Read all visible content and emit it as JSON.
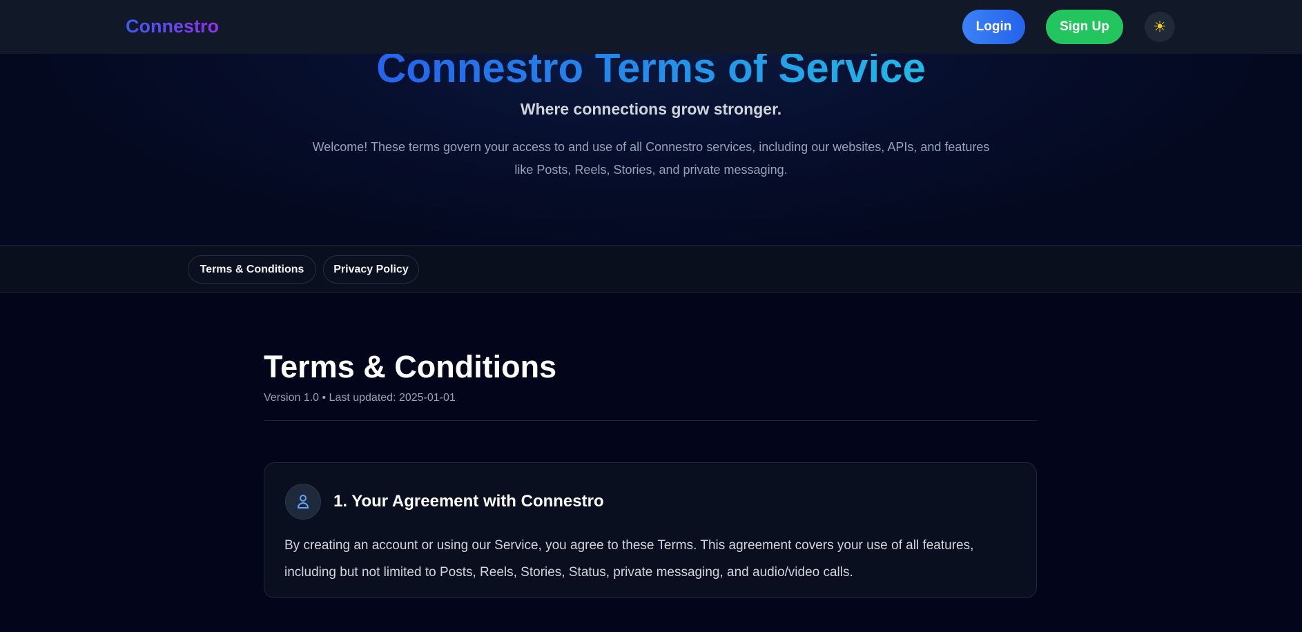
{
  "nav": {
    "logo": "Connestro",
    "login": "Login",
    "signup": "Sign Up",
    "theme_icon": "sun-icon"
  },
  "hero": {
    "title": "Connestro Terms of Service",
    "subtitle": "Where connections grow stronger.",
    "intro": "Welcome! These terms govern your access to and use of all Connestro services, including our websites, APIs, and features like Posts, Reels, Stories, and private messaging."
  },
  "tabs": [
    {
      "label": "Terms & Conditions"
    },
    {
      "label": "Privacy Policy"
    }
  ],
  "main": {
    "title": "Terms & Conditions",
    "version": "Version 1.0 • Last updated: 2025-01-01",
    "sections": [
      {
        "icon": "user-icon",
        "heading": "1. Your Agreement with Connestro",
        "body": "By creating an account or using our Service, you agree to these Terms. This agreement covers your use of all features, including but not limited to Posts, Reels, Stories, Status, private messaging, and audio/video calls."
      }
    ]
  }
}
